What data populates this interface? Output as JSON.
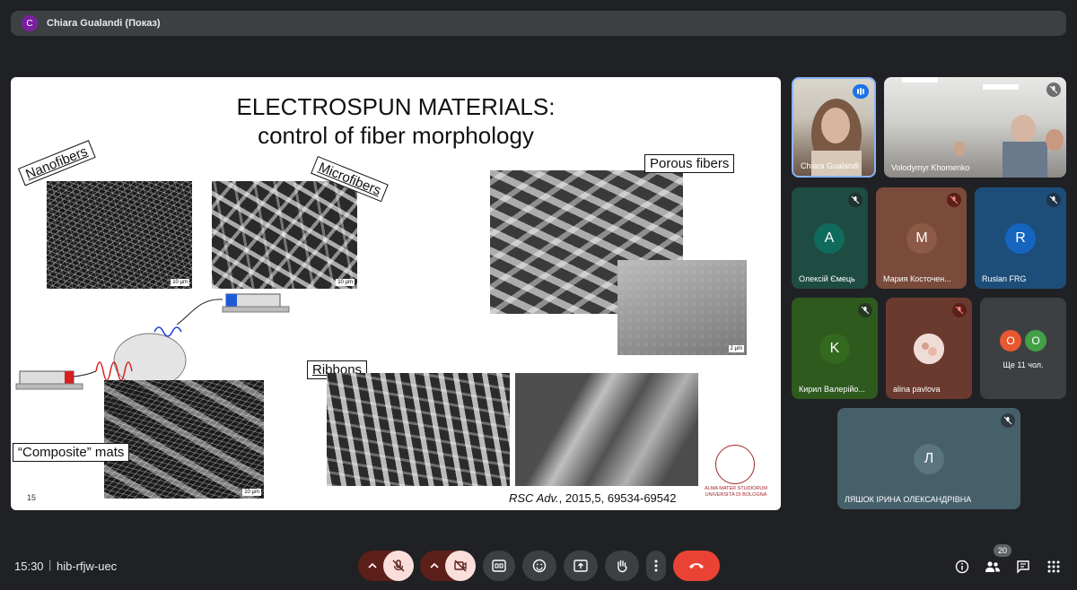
{
  "presenter_bar": {
    "avatar_letter": "C",
    "name": "Chiara Gualandi (Показ)"
  },
  "slide": {
    "title_line1": "ELECTROSPUN MATERIALS:",
    "title_line2": "control of fiber morphology",
    "labels": {
      "nanofibers": "Nanofibers",
      "microfibers": "Microfibers",
      "porous": "Porous fibers",
      "ribbons": "Ribbons",
      "composite": "“Composite” mats"
    },
    "scalebars": {
      "s10": "10 µm",
      "s2": "2 µm"
    },
    "slide_number": "15",
    "citation_journal": "RSC Adv.",
    "citation_rest": ", 2015,5, 69534-69542",
    "seal_text_line1": "ALMA MATER STUDIORUM",
    "seal_text_line2": "UNIVERSITÀ DI BOLOGNA"
  },
  "participants": [
    {
      "name": "Chiara Gualandi",
      "type": "video",
      "status": "speaking"
    },
    {
      "name": "Volodymyr Khomenko",
      "type": "video",
      "status": "muted"
    },
    {
      "name": "Олексій Ємець",
      "initial": "A",
      "bg": "#1e4b42",
      "avatar_color": "#0f6b5c",
      "status": "muted"
    },
    {
      "name": "Мария Косточен...",
      "initial": "M",
      "bg": "#7a4a3a",
      "avatar_color": "#8e5a48",
      "status": "muted-red"
    },
    {
      "name": "Ruslan FRG",
      "initial": "R",
      "bg": "#1d4e7a",
      "avatar_color": "#1565c0",
      "status": "muted"
    },
    {
      "name": "Кирил Валерійо...",
      "initial": "K",
      "bg": "#2e5a1e",
      "avatar_color": "#33691e",
      "status": "muted"
    },
    {
      "name": "alina pavlova",
      "initial": "",
      "bg": "#6b3a2e",
      "avatar_color": "#e0c8c0",
      "status": "muted-red"
    },
    {
      "name": "Ще 11 чол.",
      "bubbles": [
        "O",
        "O"
      ],
      "bubble_colors": [
        "#e8572f",
        "#43a047"
      ]
    },
    {
      "name": "ЛЯШОК ІРИНА ОЛЕКСАНДРІВНА",
      "initial": "Л",
      "bg": "#46606a",
      "avatar_color": "#5a7480",
      "status": "muted"
    }
  ],
  "bottom_bar": {
    "time": "15:30",
    "separator": "|",
    "meeting_code": "hib-rfjw-uec",
    "participant_count": "20",
    "colors": {
      "end_call": "#ea4335",
      "muted_pill": "#5c1f1a",
      "muted_circle": "#f9dedc"
    }
  }
}
